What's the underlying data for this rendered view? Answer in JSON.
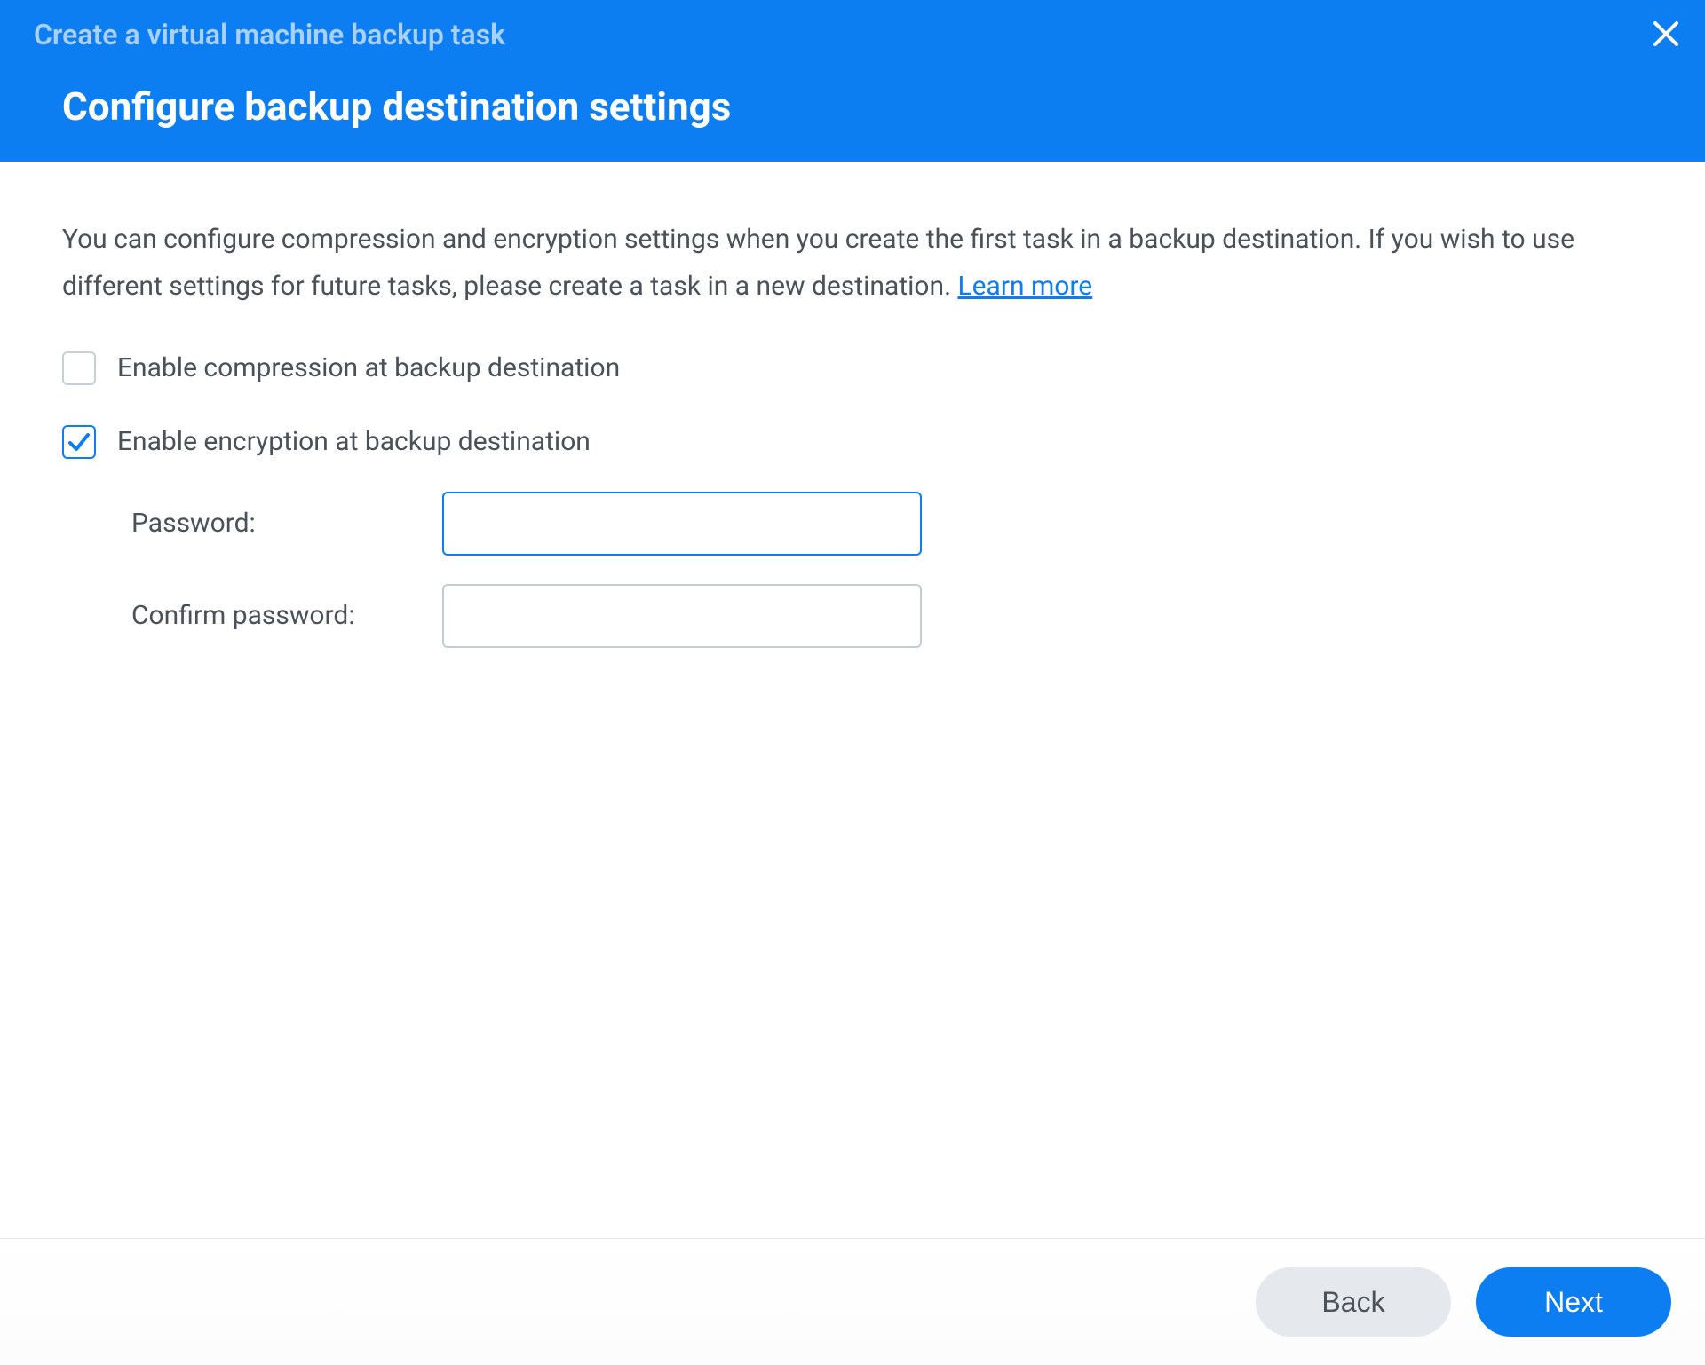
{
  "header": {
    "wizard_title": "Create a virtual machine backup task",
    "step_title": "Configure backup destination settings"
  },
  "body": {
    "intro_text": "You can configure compression and encryption settings when you create the first task in a backup destination. If you wish to use different settings for future tasks, please create a task in a new destination. ",
    "learn_more": "Learn more",
    "compression_label": "Enable compression at backup destination",
    "compression_checked": false,
    "encryption_label": "Enable encryption at backup destination",
    "encryption_checked": true,
    "password_label": "Password:",
    "password_value": "",
    "confirm_password_label": "Confirm password:",
    "confirm_password_value": ""
  },
  "footer": {
    "back_label": "Back",
    "next_label": "Next"
  }
}
